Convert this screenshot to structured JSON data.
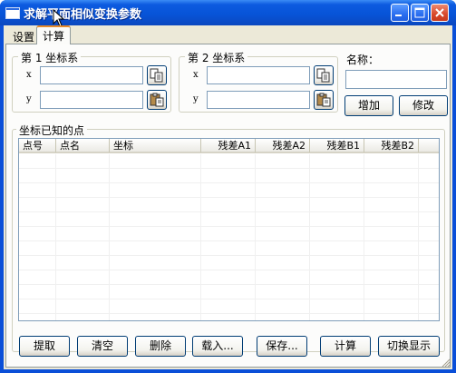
{
  "window": {
    "title": "求解平面相似变换参数",
    "icon": "app-window-icon",
    "controls": [
      "minimize-icon",
      "maximize-icon",
      "close-icon"
    ]
  },
  "tabs": [
    {
      "label": "设置",
      "active": false
    },
    {
      "label": "计算",
      "active": true
    }
  ],
  "system1": {
    "legend": "第 1 坐标系",
    "x_label": "x",
    "y_label": "y",
    "x_value": "",
    "y_value": "",
    "copy_icon": "copy-icon",
    "paste_icon": "paste-icon"
  },
  "system2": {
    "legend": "第 2 坐标系",
    "x_label": "x",
    "y_label": "y",
    "x_value": "",
    "y_value": "",
    "copy_icon": "copy-icon",
    "paste_icon": "paste-icon"
  },
  "name_panel": {
    "label": "名称：",
    "value": "",
    "add_label": "增加",
    "modify_label": "修改"
  },
  "points": {
    "legend": "坐标已知的点",
    "columns": [
      "点号",
      "点名",
      "坐标",
      "残差A1",
      "残差A2",
      "残差B1",
      "残差B2"
    ],
    "rows": []
  },
  "buttons": {
    "extract": "提取",
    "clear": "清空",
    "delete": "删除",
    "load": "载入...",
    "save": "保存...",
    "compute": "计算",
    "toggle": "切换显示"
  },
  "colors": {
    "titlebar": "#0754d8",
    "active_tab_accent": "#e68b2c",
    "dialog_face": "#ece9d8",
    "button_border": "#003c74"
  }
}
